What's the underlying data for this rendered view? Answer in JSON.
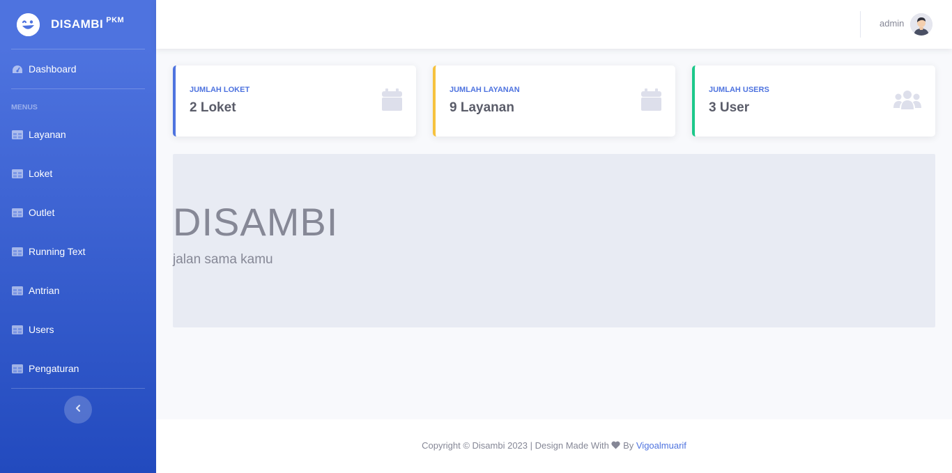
{
  "brand": {
    "name": "DISAMBI",
    "sup": "PKM",
    "icon": "wink-smile-icon"
  },
  "sidebar": {
    "dashboard": {
      "label": "Dashboard",
      "icon": "tachometer-icon"
    },
    "heading": "MENUS",
    "items": [
      {
        "label": "Layanan",
        "icon": "table-icon"
      },
      {
        "label": "Loket",
        "icon": "table-icon"
      },
      {
        "label": "Outlet",
        "icon": "table-icon"
      },
      {
        "label": "Running Text",
        "icon": "table-icon"
      },
      {
        "label": "Antrian",
        "icon": "table-icon"
      },
      {
        "label": "Users",
        "icon": "table-icon"
      },
      {
        "label": "Pengaturan",
        "icon": "table-icon"
      }
    ],
    "toggle_icon": "chevron-left-icon"
  },
  "topbar": {
    "username": "admin",
    "avatar_icon": "user-avatar"
  },
  "cards": [
    {
      "label": "JUMLAH LOKET",
      "value": "2 Loket",
      "accent": "#4e73df",
      "icon": "calendar-icon"
    },
    {
      "label": "JUMLAH LAYANAN",
      "value": "9 Layanan",
      "accent": "#f6c23e",
      "icon": "calendar-icon"
    },
    {
      "label": "JUMLAH USERS",
      "value": "3 User",
      "accent": "#1cc88a",
      "icon": "users-icon"
    }
  ],
  "jumbotron": {
    "title": "DISAMBI",
    "subtitle": "jalan sama kamu"
  },
  "footer": {
    "prefix": "Copyright © Disambi 2023 | Design Made With",
    "by": "By",
    "author": "Vigoalmuarif",
    "heart_icon": "heart-icon"
  },
  "colors": {
    "primary": "#4e73df",
    "warning": "#f6c23e",
    "success": "#1cc88a",
    "sidebar_bottom": "#224abe"
  }
}
